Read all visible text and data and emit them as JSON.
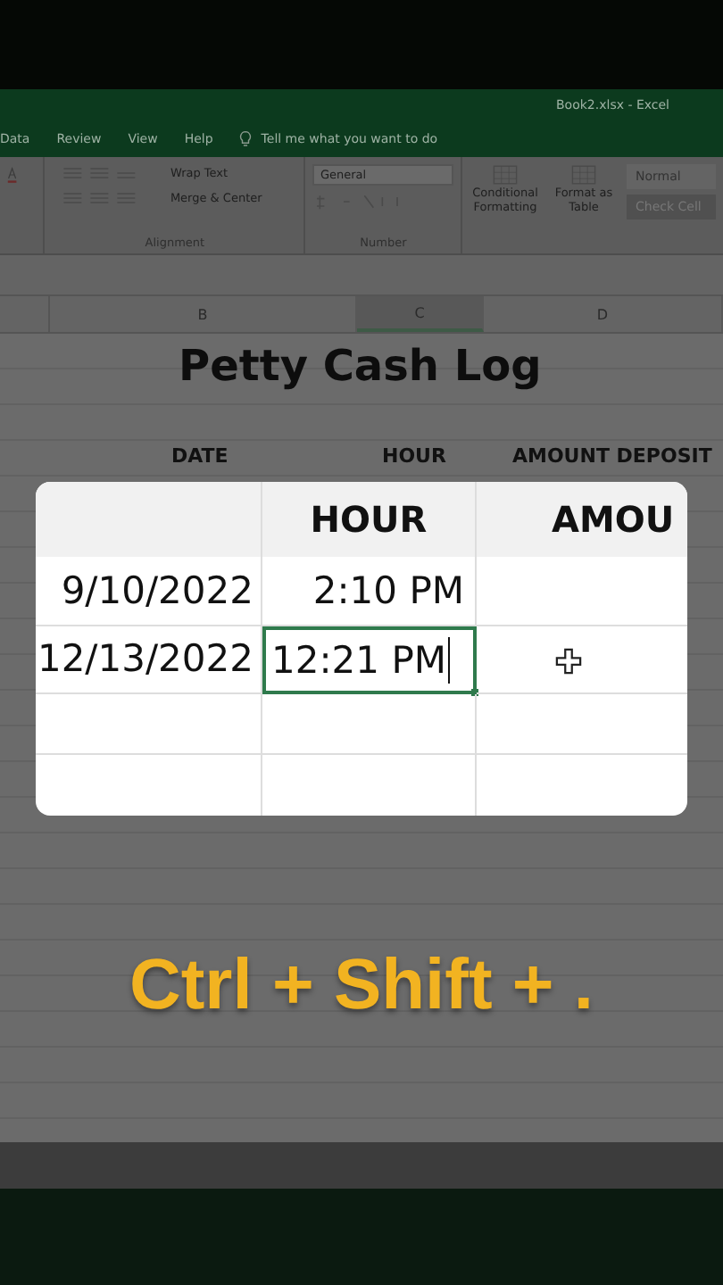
{
  "window": {
    "title": "Book2.xlsx - Excel"
  },
  "menu": {
    "items": [
      {
        "label": "Data"
      },
      {
        "label": "Review"
      },
      {
        "label": "View"
      },
      {
        "label": "Help"
      }
    ],
    "tell_me": "Tell me what you want to do"
  },
  "ribbon": {
    "alignment": {
      "wrap": "Wrap Text",
      "merge": "Merge & Center",
      "label": "Alignment"
    },
    "number": {
      "format": "General",
      "label": "Number"
    },
    "styles": {
      "conditional": "Conditional Formatting",
      "table": "Format as Table",
      "normal": "Normal",
      "check": "Check Cell"
    }
  },
  "columns": [
    {
      "label": "B",
      "selected": false
    },
    {
      "label": "C",
      "selected": true
    },
    {
      "label": "D",
      "selected": false
    }
  ],
  "sheet": {
    "title": "Petty Cash Log",
    "headers": [
      "DATE",
      "HOUR",
      "AMOUNT DEPOSIT"
    ]
  },
  "zoom_view": {
    "headers": [
      "HOUR",
      "AMOU"
    ],
    "rows": [
      {
        "date": "9/10/2022",
        "hour": "2:10 PM",
        "selected": false
      },
      {
        "date": "12/13/2022",
        "hour": "12:21 PM",
        "selected": true
      }
    ]
  },
  "caption": "Ctrl + Shift + ."
}
